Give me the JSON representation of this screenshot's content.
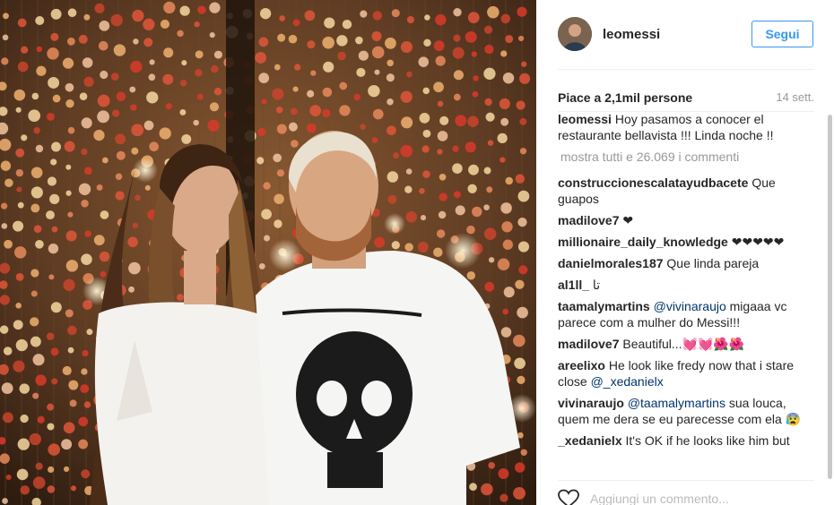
{
  "post": {
    "username": "leomessi",
    "follow_label": "Segui",
    "likes": "Piace a 2,1mil persone",
    "age": "14 sett.",
    "caption": "Hoy pasamos a conocer el restaurante bellavista !!! Linda noche !!",
    "more_comments": "mostra tutti e 26.069 i commenti",
    "add_comment_placeholder": "Aggiungi un commento..."
  },
  "comments": [
    {
      "user": "construccionescalatayudbacete",
      "text": "Que guapos"
    },
    {
      "user": "madilove7",
      "text": "❤"
    },
    {
      "user": "millionaire_daily_knowledge",
      "text": "❤❤❤❤❤"
    },
    {
      "user": "danielmorales187",
      "text": "Que linda pareja"
    },
    {
      "user": "al1ll_",
      "text": "تا"
    },
    {
      "user": "taamalymartins",
      "mention": "@vivinaraujo",
      "text": "migaaa vc parece com a mulher do Messi!!!"
    },
    {
      "user": "madilove7",
      "text": "Beautiful...💓💓🌺🌺"
    },
    {
      "user": "areelixo",
      "text": "He look like fredy now that i stare close",
      "mention_after": "@_xedanielx"
    },
    {
      "user": "vivinaraujo",
      "mention": "@taamalymartins",
      "text": "sua louca, quem me dera se eu parecesse com ela 😰"
    },
    {
      "user": "_xedanielx",
      "text": "It's OK if he looks like him but"
    }
  ],
  "colors": {
    "accent": "#3897f0",
    "mention": "#003569",
    "muted": "#999999",
    "divider": "#efefef"
  },
  "icons": {
    "like": "heart-outline-icon"
  }
}
